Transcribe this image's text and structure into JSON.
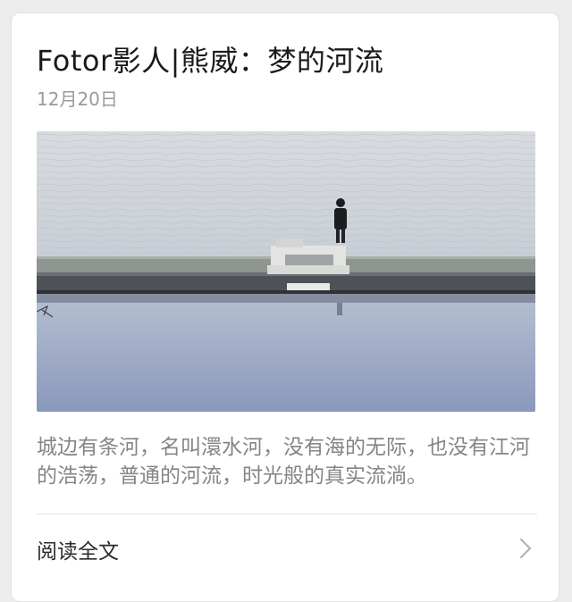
{
  "article": {
    "title": "Fotor影人|熊威：梦的河流",
    "date": "12月20日",
    "summary": "城边有条河，名叫澴水河，没有海的无际，也没有江河的浩荡，普通的河流，时光般的真实流淌。",
    "read_more_label": "阅读全文",
    "read_more_icon": "chevron-right-icon"
  },
  "colors": {
    "background": "#ececec",
    "card": "#ffffff",
    "title_text": "#1a1a1a",
    "meta_text": "#9a9a9a",
    "summary_text": "#858585",
    "water_top": "#c7cdd6",
    "water_bottom": "#8d9bbd"
  }
}
